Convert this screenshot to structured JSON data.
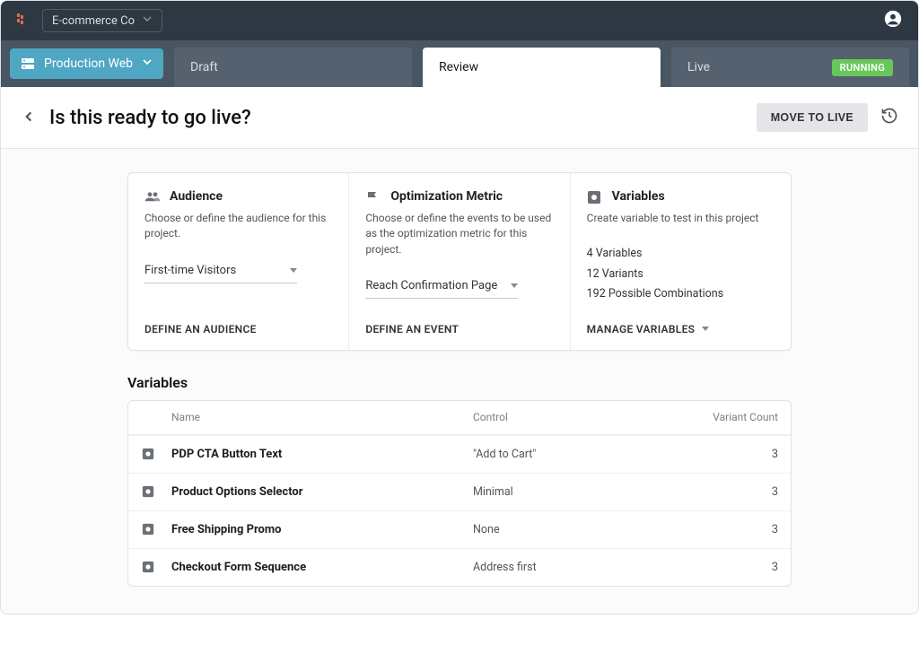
{
  "header": {
    "org": "E-commerce Co"
  },
  "environment": {
    "label": "Production Web"
  },
  "tabs": [
    {
      "label": "Draft"
    },
    {
      "label": "Review"
    },
    {
      "label": "Live",
      "badge": "RUNNING"
    }
  ],
  "page": {
    "title": "Is this ready to go live?",
    "primary_action": "MOVE TO LIVE"
  },
  "cards": {
    "audience": {
      "title": "Audience",
      "desc": "Choose or define the audience for this project.",
      "value": "First-time Visitors",
      "action": "DEFINE AN AUDIENCE"
    },
    "metric": {
      "title": "Optimization Metric",
      "desc": "Choose or define the events to be used as the optimization metric for this project.",
      "value": "Reach Confirmation Page",
      "action": "DEFINE AN EVENT"
    },
    "variables": {
      "title": "Variables",
      "desc": "Create variable to test in this project",
      "stat1": "4 Variables",
      "stat2": "12 Variants",
      "stat3": "192 Possible Combinations",
      "action": "MANAGE VARIABLES"
    }
  },
  "variables": {
    "section_title": "Variables",
    "columns": {
      "name": "Name",
      "control": "Control",
      "count": "Variant Count"
    },
    "rows": [
      {
        "name": "PDP CTA Button Text",
        "control": "\"Add to Cart\"",
        "count": "3"
      },
      {
        "name": "Product Options Selector",
        "control": "Minimal",
        "count": "3"
      },
      {
        "name": "Free Shipping Promo",
        "control": "None",
        "count": "3"
      },
      {
        "name": "Checkout Form Sequence",
        "control": "Address first",
        "count": "3"
      }
    ]
  }
}
